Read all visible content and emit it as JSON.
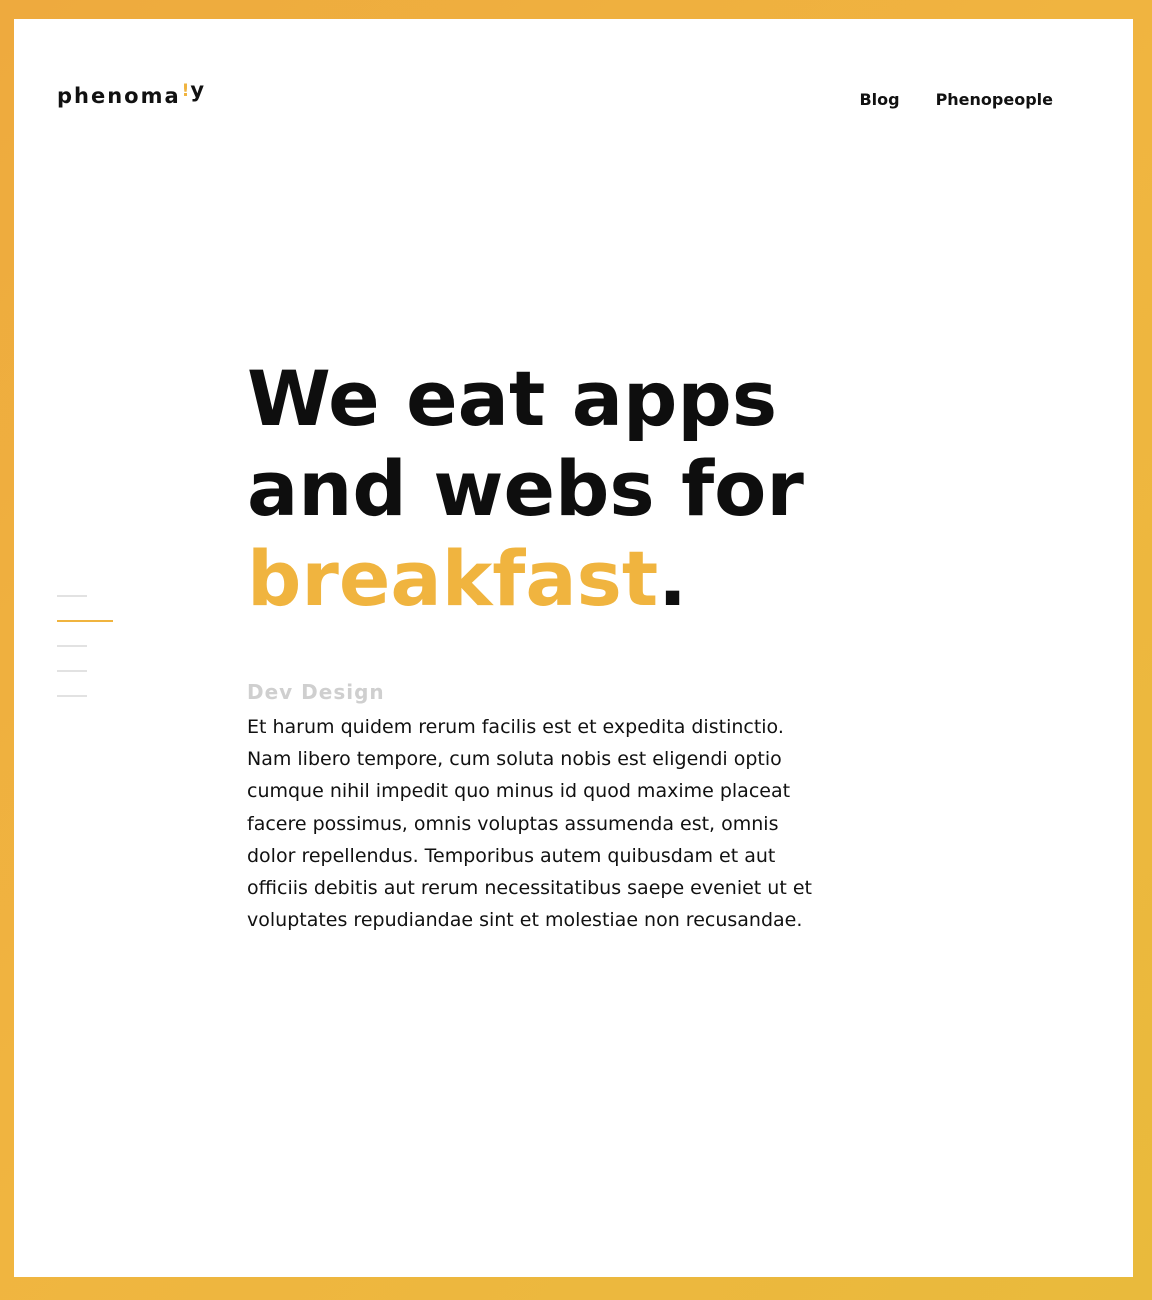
{
  "brand": {
    "logo_text": "phenoma",
    "logo_mark": "!",
    "logo_end": "y"
  },
  "nav": {
    "items": [
      {
        "label": "Blog"
      },
      {
        "label": "Phenopeople"
      }
    ]
  },
  "slider": {
    "count": 5,
    "active_index": 1
  },
  "hero": {
    "headline_line1": "We eat apps",
    "headline_line2": "and webs for",
    "headline_accent": "breakfast",
    "headline_end": ".",
    "subhead": "Dev Design",
    "body": "Et harum quidem rerum facilis est et expedita distinctio. Nam libero tempore, cum soluta nobis est eligendi optio cumque nihil impedit quo minus id quod maxime placeat facere possimus, omnis voluptas assumenda est, omnis dolor repellendus. Temporibus autem quibusdam et aut officiis debitis aut rerum necessitatibus saepe eveniet ut et voluptates repudiandae sint et molestiae non recusandae."
  },
  "colors": {
    "accent": "#f0b43f",
    "frame": "#eeaf3e",
    "text": "#111111",
    "muted": "#cfcfcf"
  }
}
